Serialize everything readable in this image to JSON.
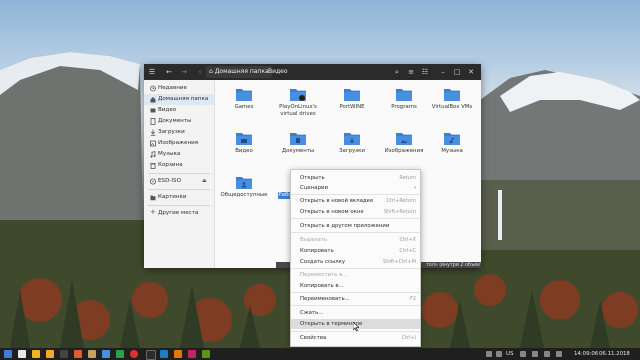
{
  "window": {
    "breadcrumb": {
      "home": "Домашняя папка",
      "current": "Видео"
    }
  },
  "sidebar": {
    "items": [
      {
        "label": "Недавние",
        "icon": "clock-icon"
      },
      {
        "label": "Домашняя папка",
        "icon": "home-icon"
      },
      {
        "label": "Видео",
        "icon": "video-icon"
      },
      {
        "label": "Документы",
        "icon": "document-icon"
      },
      {
        "label": "Загрузки",
        "icon": "download-icon"
      },
      {
        "label": "Изображения",
        "icon": "image-icon"
      },
      {
        "label": "Музыка",
        "icon": "music-icon"
      },
      {
        "label": "Корзина",
        "icon": "trash-icon"
      },
      {
        "label": "ESD-ISO",
        "icon": "drive-icon"
      },
      {
        "label": "Картинки",
        "icon": "folder-icon"
      },
      {
        "label": "Другие места",
        "icon": "plus-icon"
      }
    ]
  },
  "files": [
    {
      "name": "Games"
    },
    {
      "name": "PlayOnLinux's virtual drives"
    },
    {
      "name": "PortWINE"
    },
    {
      "name": "Programs"
    },
    {
      "name": "VirtualBox VMs"
    },
    {
      "name": "Видео"
    },
    {
      "name": "Документы"
    },
    {
      "name": "Загрузки"
    },
    {
      "name": "Изображения"
    },
    {
      "name": "Музыка"
    },
    {
      "name": "Общедоступные"
    },
    {
      "name": "Рабо"
    }
  ],
  "status": {
    "text": "тол» (внутри 2 объекта)"
  },
  "context_menu": {
    "items": [
      {
        "label": "Открыть",
        "shortcut": "Return"
      },
      {
        "label": "Сценарии",
        "shortcut": "›"
      },
      {
        "label": "Открыть в новой вкладке",
        "shortcut": "Ctrl+Return"
      },
      {
        "label": "Открыть в новом окне",
        "shortcut": "Shift+Return"
      },
      {
        "label": "Открыть в другом приложении",
        "shortcut": ""
      },
      {
        "label": "Вырезать",
        "shortcut": "Ctrl+X"
      },
      {
        "label": "Копировать",
        "shortcut": "Ctrl+C"
      },
      {
        "label": "Создать ссылку",
        "shortcut": "Shift+Ctrl+M"
      },
      {
        "label": "Переместить в...",
        "shortcut": ""
      },
      {
        "label": "Копировать в...",
        "shortcut": ""
      },
      {
        "label": "Переименовать...",
        "shortcut": "F2"
      },
      {
        "label": "Сжать...",
        "shortcut": ""
      },
      {
        "label": "Открыть в терминале",
        "shortcut": ""
      },
      {
        "label": "Свойства",
        "shortcut": "Ctrl+I"
      }
    ]
  },
  "taskbar": {
    "keyboard_layout": "US",
    "time": "14:09:06",
    "date": "06.11.2018"
  },
  "colors": {
    "folder": "#3d7fd1",
    "headerbar": "#2b2b2b",
    "accent": "#3d7fd1"
  }
}
